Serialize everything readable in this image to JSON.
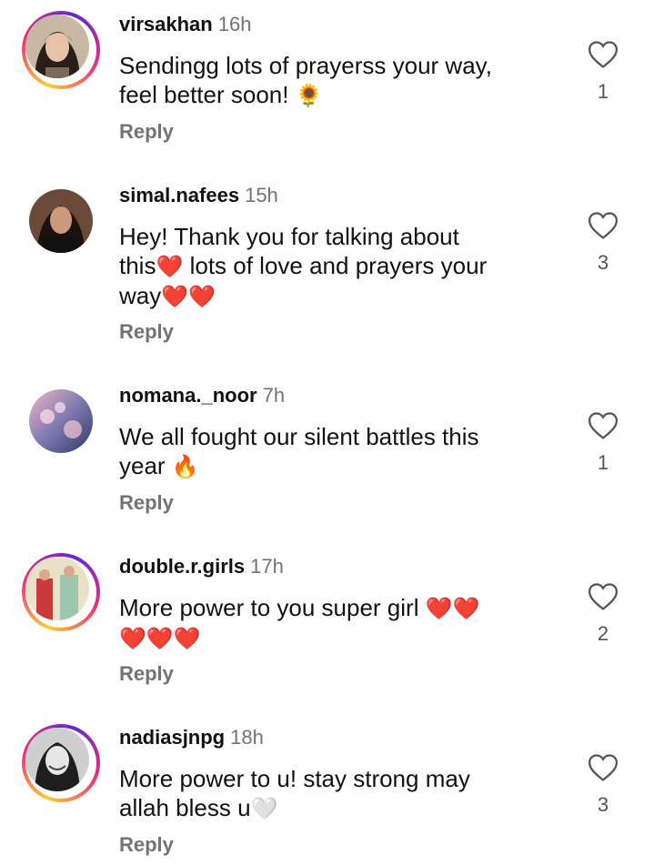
{
  "comments": [
    {
      "username": "virsakhan",
      "time": "16h",
      "text_pre": "Sendingg lots of prayerss your way,\nfeel better soon! ",
      "emoji": "🌻",
      "text_post": "",
      "reply": "Reply",
      "likes": "1"
    },
    {
      "username": "simal.nafees",
      "time": "15h",
      "text_pre": "Hey! Thank you for talking about\nthis",
      "emoji": "❤️",
      "text_post": " lots of love and prayers your\nway",
      "emoji2": "❤️❤️",
      "reply": "Reply",
      "likes": "3"
    },
    {
      "username": "nomana._noor",
      "time": "7h",
      "text_pre": "We all fought our silent battles this\nyear ",
      "emoji": "🔥",
      "text_post": "",
      "reply": "Reply",
      "likes": "1"
    },
    {
      "username": "double.r.girls",
      "time": "17h",
      "text_pre": "More power to you super girl ",
      "emoji": "❤️❤️",
      "text_post": "\n",
      "emoji2": "❤️❤️❤️",
      "reply": "Reply",
      "likes": "2"
    },
    {
      "username": "nadiasjnpg",
      "time": "18h",
      "text_pre": "More power to u! stay strong may\nallah bless u",
      "emoji": "🤍",
      "text_post": "",
      "reply": "Reply",
      "likes": "3"
    }
  ]
}
